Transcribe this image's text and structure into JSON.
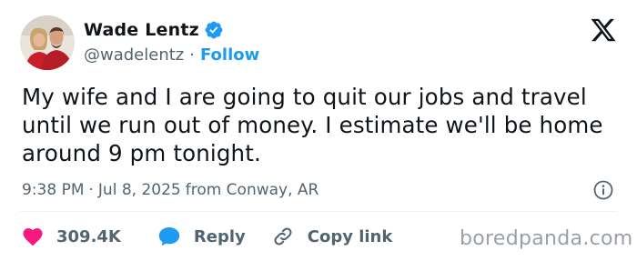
{
  "author": {
    "display_name": "Wade Lentz",
    "handle": "@wadelentz",
    "separator": "·",
    "follow_label": "Follow",
    "verified_color": "#1d9bf0"
  },
  "tweet": {
    "text": "My wife and I are going to quit our jobs and travel until we run out of money. I estimate we'll be home around 9 pm tonight.",
    "time": "9:38 PM",
    "separator": "·",
    "date": "Jul 8, 2025",
    "location": "from Conway, AR"
  },
  "actions": {
    "like_count": "309.4K",
    "reply_label": "Reply",
    "copy_link_label": "Copy link"
  },
  "icons": {
    "brand": "x-logo-icon",
    "verified": "verified-badge-icon",
    "info": "info-icon",
    "like": "heart-icon",
    "reply": "speech-bubble-icon",
    "copy": "link-icon"
  },
  "colors": {
    "accent": "#1d9bf0",
    "heart": "#f91880",
    "muted": "#536471",
    "text": "#0f1419"
  },
  "watermark": "boredpanda.com"
}
